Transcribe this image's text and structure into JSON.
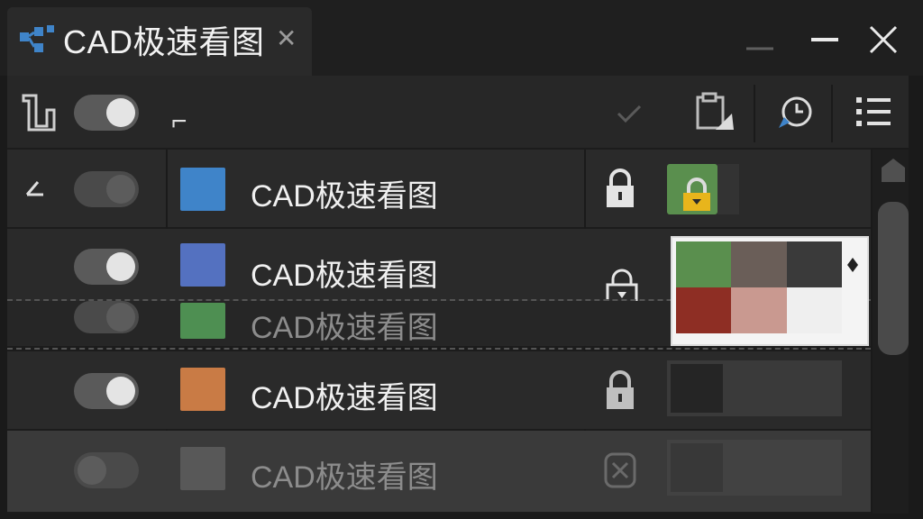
{
  "window": {
    "title": "CAD极速看图"
  },
  "toolbar": {
    "cursor_text": "⌐"
  },
  "layers": [
    {
      "name": "CAD极速看图",
      "color": "#3f84c9",
      "visible": true,
      "dim": false,
      "locked": true
    },
    {
      "name": "CAD极速看图",
      "color": "#5471c0",
      "visible": true,
      "dim": false,
      "locked": true
    },
    {
      "name": "CAD极速看图",
      "color": "#4e8f52",
      "visible": false,
      "dim": true,
      "locked": true
    },
    {
      "name": "CAD极速看图",
      "color": "#c97b45",
      "visible": true,
      "dim": false,
      "locked": true
    },
    {
      "name": "CAD极速看图",
      "color": "#585858",
      "visible": false,
      "dim": true,
      "locked": false
    }
  ],
  "palette": {
    "colors": [
      "#5a8f4e",
      "#6a5e58",
      "#3a3a3a",
      "#8e2e24",
      "#c99990",
      "#efefef"
    ]
  },
  "colors": {
    "accent": "#3f84c9",
    "lock_badge": "#e8b51c"
  }
}
